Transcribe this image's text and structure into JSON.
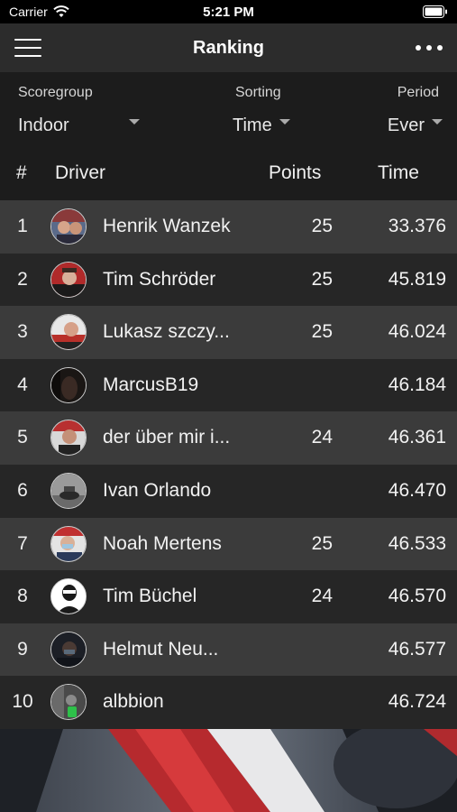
{
  "status": {
    "carrier": "Carrier",
    "time": "5:21 PM"
  },
  "nav": {
    "title": "Ranking"
  },
  "filters": {
    "scoregroup": {
      "label": "Scoregroup",
      "value": "Indoor"
    },
    "sorting": {
      "label": "Sorting",
      "value": "Time"
    },
    "period": {
      "label": "Period",
      "value": "Ever"
    }
  },
  "columns": {
    "rank": "#",
    "driver": "Driver",
    "points": "Points",
    "time": "Time"
  },
  "rows": [
    {
      "rank": "1",
      "name": "Henrik Wanzek",
      "points": "25",
      "time": "33.376"
    },
    {
      "rank": "2",
      "name": "Tim Schröder",
      "points": "25",
      "time": "45.819"
    },
    {
      "rank": "3",
      "name": "Lukasz szczy...",
      "points": "25",
      "time": "46.024"
    },
    {
      "rank": "4",
      "name": "MarcusB19",
      "points": "",
      "time": "46.184"
    },
    {
      "rank": "5",
      "name": "der über mir i...",
      "points": "24",
      "time": "46.361"
    },
    {
      "rank": "6",
      "name": "Ivan Orlando",
      "points": "",
      "time": "46.470"
    },
    {
      "rank": "7",
      "name": "Noah Mertens",
      "points": "25",
      "time": "46.533"
    },
    {
      "rank": "8",
      "name": "Tim Büchel",
      "points": "24",
      "time": "46.570"
    },
    {
      "rank": "9",
      "name": "Helmut Neu...",
      "points": "",
      "time": "46.577"
    },
    {
      "rank": "10",
      "name": "albbion",
      "points": "",
      "time": "46.724"
    }
  ]
}
